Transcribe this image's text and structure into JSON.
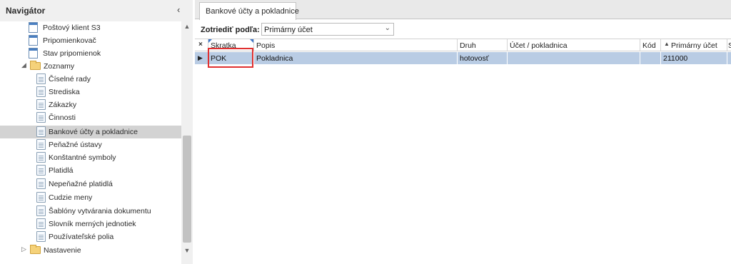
{
  "navigator": {
    "title": "Navigátor",
    "collapse_icon": "chevron-left-icon",
    "collapse_glyph": "‹",
    "scroll_up_glyph": "▲",
    "scroll_down_glyph": "▼",
    "expander_open_glyph": "◢",
    "expander_closed_glyph": "▷",
    "items": [
      {
        "label": "Poštový klient S3",
        "icon": "form-icon"
      },
      {
        "label": "Pripomienkovač",
        "icon": "form-icon"
      },
      {
        "label": "Stav pripomienok",
        "icon": "form-icon"
      },
      {
        "label": "Zoznamy",
        "icon": "folder-icon",
        "expanded": true
      },
      {
        "label": "Číselné rady",
        "icon": "document-icon"
      },
      {
        "label": "Strediska",
        "icon": "document-icon"
      },
      {
        "label": "Zákazky",
        "icon": "document-icon"
      },
      {
        "label": "Činnosti",
        "icon": "document-icon"
      },
      {
        "label": "Bankové účty a pokladnice",
        "icon": "document-icon",
        "selected": true
      },
      {
        "label": "Peňažné ústavy",
        "icon": "document-icon"
      },
      {
        "label": "Konštantné symboly",
        "icon": "document-icon"
      },
      {
        "label": "Platidlá",
        "icon": "document-icon"
      },
      {
        "label": "Nepeňažné platidlá",
        "icon": "document-icon"
      },
      {
        "label": "Cudzie meny",
        "icon": "document-icon"
      },
      {
        "label": "Šablóny vytvárania dokumentu",
        "icon": "document-icon"
      },
      {
        "label": "Slovník merných jednotiek",
        "icon": "document-icon"
      },
      {
        "label": "Používateľské polia",
        "icon": "document-icon"
      },
      {
        "label": "Nastavenie",
        "icon": "folder-icon",
        "expanded": false
      }
    ]
  },
  "tabs": [
    {
      "label": "Bankové účty a pokladnice",
      "active": true
    }
  ],
  "sort": {
    "label": "Zotriediť podľa:",
    "selected": "Primárny účet",
    "dropdown_glyph": "⌄"
  },
  "grid": {
    "corner_glyph": "×",
    "sort_glyph": "▲",
    "row_indicator_glyph": "▶",
    "columns": [
      "Skratka",
      "Popis",
      "Druh",
      "Účet / pokladnica",
      "Kód",
      "Primárny účet",
      "S"
    ],
    "rows": [
      [
        "POK",
        "Pokladnica",
        "hotovosť",
        "",
        "",
        "211000",
        ""
      ]
    ]
  },
  "colors": {
    "selected_row": "#b9cce4",
    "highlight_box": "#e03030",
    "filter_mark": "#3b74c7",
    "nav_selected": "#d3d3d3"
  }
}
